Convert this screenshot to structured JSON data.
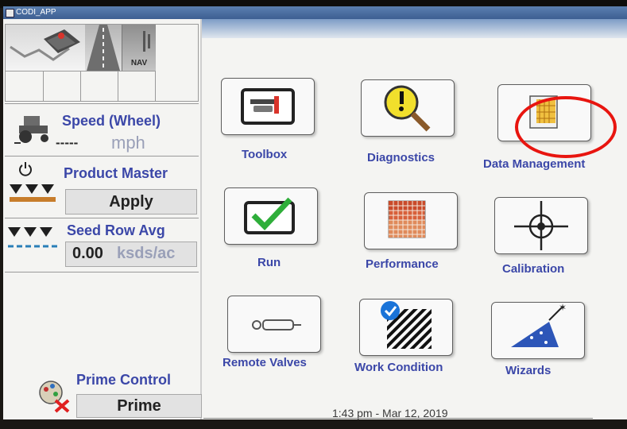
{
  "window": {
    "title": "CODI_APP"
  },
  "nav": {
    "nav_label": "NAV"
  },
  "left": {
    "speed": {
      "label": "Speed (Wheel)",
      "value": "-----",
      "unit": "mph"
    },
    "product_master": {
      "label": "Product Master",
      "mode": "Apply"
    },
    "seed_row": {
      "label": "Seed Row Avg",
      "value": "0.00",
      "unit": "ksds/ac"
    },
    "prime_control": {
      "label": "Prime Control",
      "button": "Prime"
    }
  },
  "menu": {
    "toolbox": "Toolbox",
    "diagnostics": "Diagnostics",
    "data_management": "Data Management",
    "run": "Run",
    "performance": "Performance",
    "calibration": "Calibration",
    "remote_valves": "Remote Valves",
    "work_condition": "Work Condition",
    "wizards": "Wizards"
  },
  "status": {
    "datetime": "1:43 pm - Mar 12, 2019"
  },
  "colors": {
    "label_blue": "#3b47a8",
    "annotation_red": "#e8150f",
    "check_green": "#2fae3a",
    "diag_yellow": "#f1df2c"
  },
  "icons": {
    "toolbox": "toolbox-icon",
    "diagnostics": "magnifier-exclamation-icon",
    "data_management": "data-card-icon",
    "run": "checkmark-icon",
    "performance": "grid-map-icon",
    "calibration": "crosshair-icon",
    "remote_valves": "hydraulic-cylinder-icon",
    "work_condition": "hatched-field-check-icon",
    "wizards": "wizard-hat-icon"
  }
}
